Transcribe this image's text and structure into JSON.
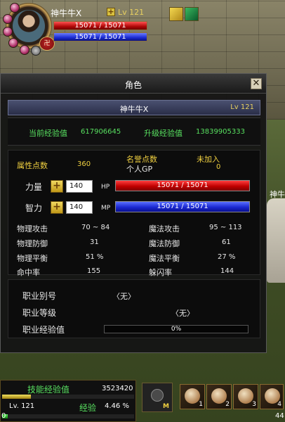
{
  "player": {
    "name": "神牛牛X",
    "level": "Lv 121",
    "hp_text": "15071 / 15071",
    "mp_text": "15071 / 15071",
    "hp_fraction": 1.0,
    "mp_fraction": 1.0,
    "pk_badge": "卍"
  },
  "npc_name": "神牛",
  "panel": {
    "title": "角色",
    "close_symbol": "✕",
    "header_name": "神牛牛X",
    "header_level": "Lv 121",
    "exp": {
      "current_label": "当前经验值",
      "current_value": "617906645",
      "upgrade_label": "升级经验值",
      "upgrade_value": "13839905333"
    },
    "attr": {
      "points_label": "属性点数",
      "points_value": "360",
      "honor_label": "名誉点数",
      "pgp_label": "个人GP",
      "join_label": "未加入",
      "pgp_value": "0"
    },
    "strength": {
      "label": "力量",
      "value": "140",
      "bar_code": "HP",
      "bar_text": "15071 / 15071",
      "fraction": 1.0
    },
    "intelligence": {
      "label": "智力",
      "value": "140",
      "bar_code": "MP",
      "bar_text": "15071 / 15071",
      "fraction": 1.0
    },
    "combat": {
      "phys_atk_label": "物理攻击",
      "phys_atk_value": "70 ~ 84",
      "mag_atk_label": "魔法攻击",
      "mag_atk_value": "95 ~ 113",
      "phys_def_label": "物理防御",
      "phys_def_value": "31",
      "mag_def_label": "魔法防御",
      "mag_def_value": "61",
      "phys_bal_label": "物理平衡",
      "phys_bal_value": "51 %",
      "mag_bal_label": "魔法平衡",
      "mag_bal_value": "27 %",
      "hit_label": "命中率",
      "hit_value": "155",
      "dodge_label": "躲闪率",
      "dodge_value": "144"
    },
    "job": {
      "alias_label": "职业别号",
      "alias_value": "〈无〉",
      "level_label": "职业等级",
      "level_value": "〈无〉",
      "exp_label": "职业经验值",
      "exp_value": "0%",
      "exp_fraction": 0
    }
  },
  "hud": {
    "skill_exp_label": "技能经验值",
    "skill_exp_value": "3523420",
    "skill_exp_fraction": 0.22,
    "level": "Lv. 121",
    "exp_label": "经验",
    "exp_pct": "4.46 %",
    "exp_fraction": 0.0446,
    "zero": "0",
    "menu_letter": "M",
    "slot_numbers": [
      "1",
      "2",
      "3",
      "4"
    ],
    "corner_number": "44"
  },
  "colors": {
    "green_label": "#58e060",
    "yellow_label": "#f0d040",
    "hp_red": "#c00000",
    "mp_blue": "#1a28d0"
  }
}
